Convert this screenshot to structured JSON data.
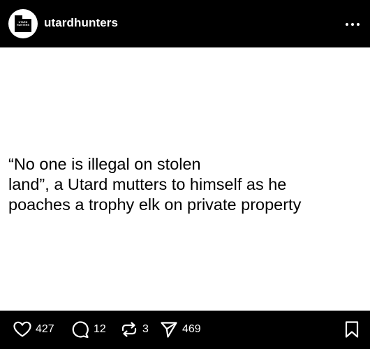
{
  "header": {
    "avatar_text": "UTARD HUNTERS",
    "username": "utardhunters",
    "more_icon": "more-horizontal-icon"
  },
  "post": {
    "quote": "“No one is illegal on stolen\nland”, a Utard mutters to himself as he\npoaches a trophy elk on private property"
  },
  "actions": {
    "like_icon": "heart-icon",
    "like_count": "427",
    "comment_icon": "comment-bubble-icon",
    "comment_count": "12",
    "repost_icon": "repost-icon",
    "repost_count": "3",
    "share_icon": "send-icon",
    "share_count": "469",
    "bookmark_icon": "bookmark-icon"
  },
  "colors": {
    "bar_background": "#000000",
    "content_background": "#ffffff",
    "text_dark": "#000000",
    "text_light": "#ffffff"
  }
}
